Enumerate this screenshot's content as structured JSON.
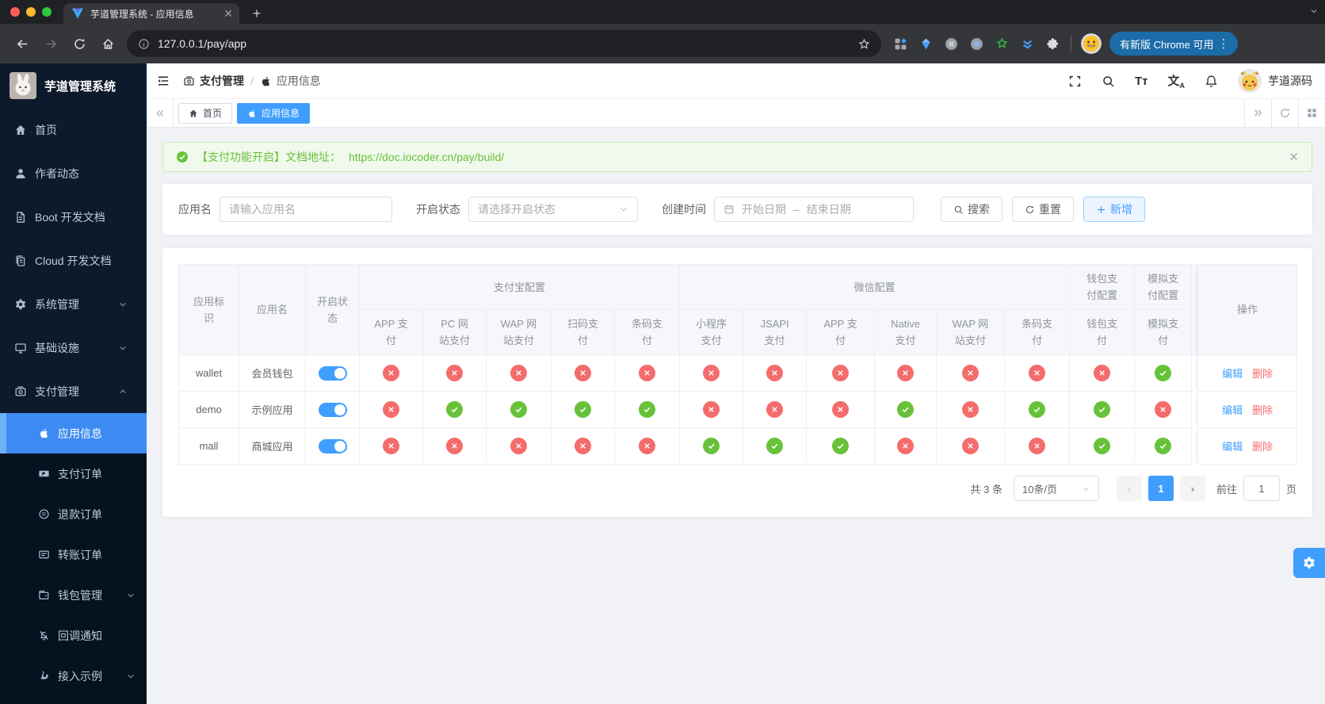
{
  "browser": {
    "tab_title": "芋道管理系统 - 应用信息",
    "url": "127.0.0.1/pay/app",
    "update_button": "有新版 Chrome 可用",
    "extension_icons": [
      "blocks-icon",
      "gem-icon",
      "command-icon",
      "dot-circle-icon",
      "star-green-icon",
      "chevrons-blue-icon",
      "puzzle-icon"
    ]
  },
  "sidebar": {
    "logo_title": "芋道管理系统",
    "menu": [
      {
        "label": "首页",
        "icon": "home-icon",
        "arrow": ""
      },
      {
        "label": "作者动态",
        "icon": "user-icon",
        "arrow": ""
      },
      {
        "label": "Boot 开发文档",
        "icon": "document-icon",
        "arrow": ""
      },
      {
        "label": "Cloud 开发文档",
        "icon": "documents-icon",
        "arrow": ""
      },
      {
        "label": "系统管理",
        "icon": "gear-icon",
        "arrow": "down"
      },
      {
        "label": "基础设施",
        "icon": "monitor-icon",
        "arrow": "down"
      },
      {
        "label": "支付管理",
        "icon": "payment-icon",
        "arrow": "up"
      }
    ],
    "submenu": [
      {
        "label": "应用信息",
        "icon": "apple-icon",
        "active": true,
        "arrow": ""
      },
      {
        "label": "支付订单",
        "icon": "paypal-icon",
        "arrow": ""
      },
      {
        "label": "退款订单",
        "icon": "registered-icon",
        "arrow": ""
      },
      {
        "label": "转账订单",
        "icon": "transfer-icon",
        "arrow": ""
      },
      {
        "label": "钱包管理",
        "icon": "wallet-icon",
        "arrow": "down"
      },
      {
        "label": "回调通知",
        "icon": "notify-icon",
        "arrow": ""
      },
      {
        "label": "接入示例",
        "icon": "swan-icon",
        "arrow": "down"
      }
    ]
  },
  "navbar": {
    "breadcrumb": [
      {
        "label": "支付管理",
        "icon": "payment-icon"
      },
      {
        "label": "应用信息",
        "icon": "apple-icon"
      }
    ],
    "action_icons": [
      "fullscreen-icon",
      "search-icon",
      "font-size-icon",
      "locale-icon",
      "bell-icon"
    ],
    "username": "芋道源码"
  },
  "tagsbar": {
    "tags": [
      {
        "label": "首页",
        "icon": "home-icon",
        "active": false
      },
      {
        "label": "应用信息",
        "icon": "apple-icon",
        "active": true
      }
    ]
  },
  "alert": {
    "message": "【支付功能开启】文档地址：",
    "link": "https://doc.iocoder.cn/pay/build/"
  },
  "filters": {
    "app_name_label": "应用名",
    "app_name_placeholder": "请输入应用名",
    "status_label": "开启状态",
    "status_placeholder": "请选择开启状态",
    "date_label": "创建时间",
    "date_start": "开始日期",
    "date_separator": "–",
    "date_end": "结束日期",
    "search_button": "搜索",
    "reset_button": "重置",
    "create_button": "新增"
  },
  "table": {
    "fixed_columns": [
      "应用标识",
      "应用名",
      "开启状态"
    ],
    "groups": [
      {
        "label": "支付宝配置",
        "children": [
          "APP 支付",
          "PC 网站支付",
          "WAP 网站支付",
          "扫码支付",
          "条码支付"
        ]
      },
      {
        "label": "微信配置",
        "children": [
          "小程序支付",
          "JSAPI 支付",
          "APP 支付",
          "Native 支付",
          "WAP 网站支付",
          "条码支付"
        ]
      },
      {
        "label": "钱包支付配置",
        "children": [
          "钱包支付"
        ]
      },
      {
        "label": "模拟支付配置",
        "children": [
          "模拟支付"
        ]
      }
    ],
    "action_column": "操作",
    "actions": [
      "编辑",
      "删除"
    ],
    "rows": [
      {
        "app_id": "wallet",
        "app_name": "会员钱包",
        "enabled": true,
        "statuses": [
          false,
          false,
          false,
          false,
          false,
          false,
          false,
          false,
          false,
          false,
          false,
          false,
          true
        ]
      },
      {
        "app_id": "demo",
        "app_name": "示例应用",
        "enabled": true,
        "statuses": [
          false,
          true,
          true,
          true,
          true,
          false,
          false,
          false,
          true,
          false,
          true,
          true,
          false
        ]
      },
      {
        "app_id": "mall",
        "app_name": "商城应用",
        "enabled": true,
        "statuses": [
          false,
          false,
          false,
          false,
          false,
          true,
          true,
          true,
          false,
          false,
          false,
          true,
          true
        ]
      }
    ]
  },
  "pagination": {
    "total": "共 3 条",
    "page_size": "10条/页",
    "current_page": "1",
    "goto_label": "前往",
    "goto_value": "1",
    "unit": "页"
  },
  "colors": {
    "primary": "#409eff",
    "success": "#67c23a",
    "danger": "#f56c6c"
  }
}
